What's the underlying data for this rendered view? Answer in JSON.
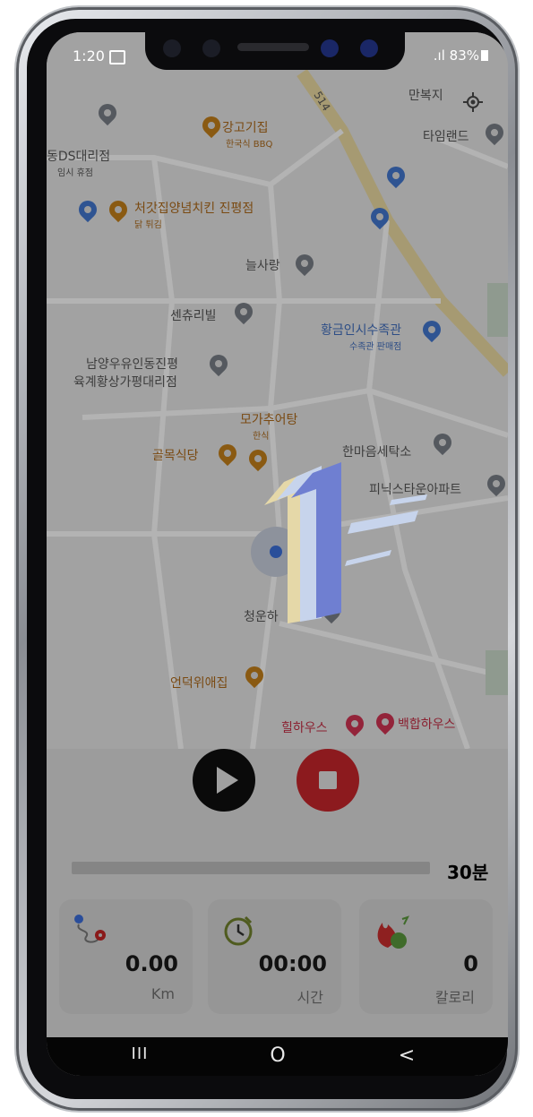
{
  "status": {
    "time": "1:20",
    "battery": "83%"
  },
  "map": {
    "labels": [
      {
        "text": "만복지"
      },
      {
        "text": "타임랜드"
      },
      {
        "text": "강고기집"
      },
      {
        "text": "한국식 BBQ"
      },
      {
        "text": "동DS대리점"
      },
      {
        "text": "임시 휴점"
      },
      {
        "text": "처갓집양념치킨 진평점"
      },
      {
        "text": "닭 튀김"
      },
      {
        "text": "늘사랑"
      },
      {
        "text": "센츄리빌"
      },
      {
        "text": "황금인시수족관"
      },
      {
        "text": "수족관 판매점"
      },
      {
        "text": "남양우유인동진평"
      },
      {
        "text": "육계황상가평대리점"
      },
      {
        "text": "모가추어탕"
      },
      {
        "text": "한식"
      },
      {
        "text": "골목식당"
      },
      {
        "text": "한마음세탁소"
      },
      {
        "text": "피닉스타운아파트"
      },
      {
        "text": "청운하"
      },
      {
        "text": "언덕위애집"
      },
      {
        "text": "힐하우스"
      },
      {
        "text": "백합하우스"
      },
      {
        "text": "514"
      }
    ]
  },
  "countdown": {
    "number": "1"
  },
  "controls": {
    "play_icon": "play-icon",
    "stop_icon": "stop-icon"
  },
  "progress": {
    "fraction": 0.0,
    "goal_label": "30분"
  },
  "stats": [
    {
      "icon": "route-icon",
      "value": "0.00",
      "unit": "Km"
    },
    {
      "icon": "timer-icon",
      "value": "00:00",
      "unit": "시간"
    },
    {
      "icon": "calorie-fire-icon",
      "value": "0",
      "unit": "칼로리"
    }
  ],
  "navbar": {
    "recents": "III",
    "home": "O",
    "back": "<"
  }
}
